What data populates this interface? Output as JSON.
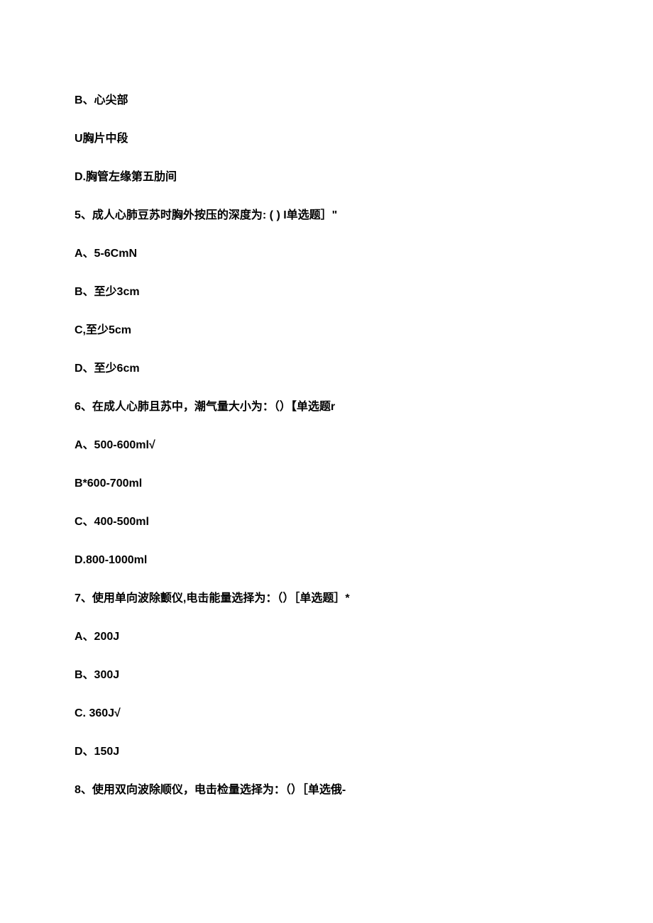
{
  "lines": [
    "B、心尖部",
    "U胸片中段",
    "D.胸管左缘第五肋间",
    "5、成人心肺豆苏时胸外按压的深度为: ( ) I单选题］\"",
    "A、5-6CmN",
    "B、至少3cm",
    "C,至少5cm",
    "D、至少6cm",
    "6、在成人心肺且苏中，潮气量大小为：（）【单选题r",
    "A、500-600ml√",
    "B*600-700ml",
    "C、400-500ml",
    "D.800-1000ml",
    "7、使用单向波除颤仪,电击能量选择为：（）［单选题］*",
    "A、200J",
    "B、300J",
    "C.    360J√",
    "D、150J",
    "8、使用双向波除顺仪，电击检量选择为：（）［单选俄-"
  ]
}
